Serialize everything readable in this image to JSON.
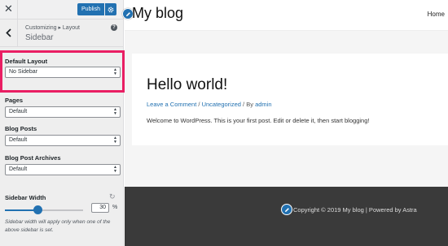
{
  "customizer": {
    "close_glyph": "✕",
    "publish_label": "Publish",
    "breadcrumb": "Customizing ▸ Layout",
    "section_title": "Sidebar",
    "help_glyph": "?",
    "controls": {
      "default_layout": {
        "label": "Default Layout",
        "value": "No Sidebar"
      },
      "pages": {
        "label": "Pages",
        "value": "Default"
      },
      "blog_posts": {
        "label": "Blog Posts",
        "value": "Default"
      },
      "blog_post_archives": {
        "label": "Blog Post Archives",
        "value": "Default"
      }
    },
    "sidebar_width": {
      "label": "Sidebar Width",
      "value": "30",
      "unit": "%",
      "slider_fraction": 0.42,
      "description": "Sidebar width will apply only when one of the above sidebar is set."
    },
    "highlight_color": "#e91e63",
    "accent_color": "#2271b1"
  },
  "preview": {
    "site_title": "My blog",
    "nav_item": "Home",
    "post": {
      "title": "Hello world!",
      "meta_comment": "Leave a Comment",
      "meta_category": "Uncategorized",
      "meta_author_prefix": "By",
      "meta_author": "admin",
      "body": "Welcome to WordPress. This is your first post. Edit or delete it, then start blogging!"
    },
    "footer_text": "Copyright © 2019 My blog | Powered by Astra"
  }
}
